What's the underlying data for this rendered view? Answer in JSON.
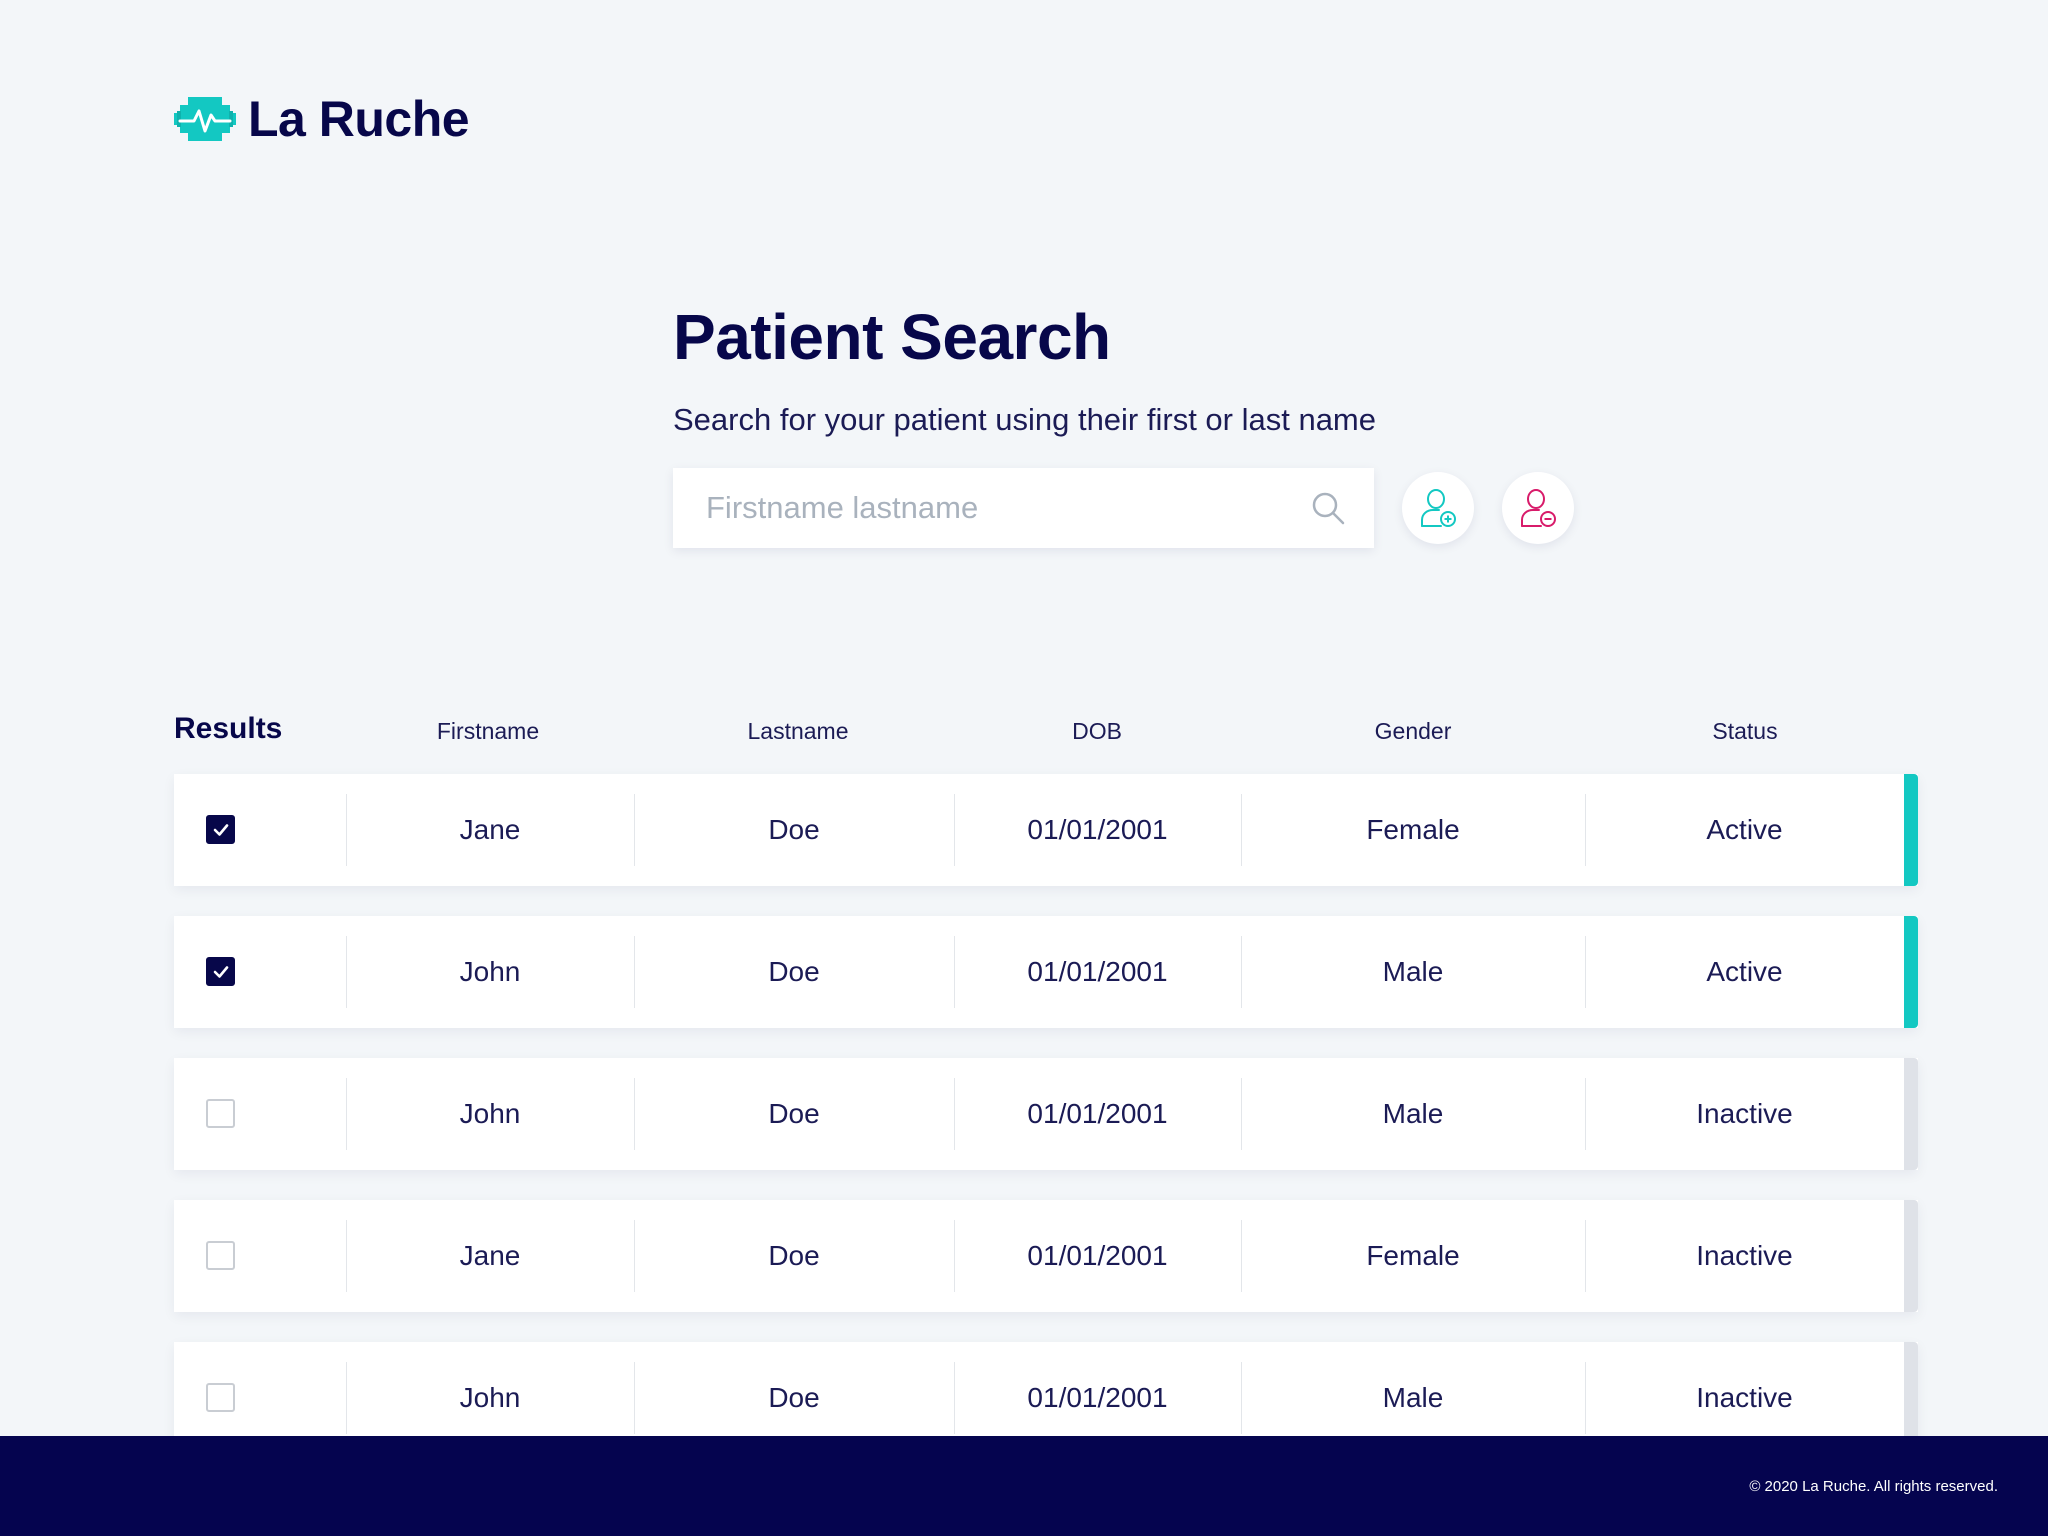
{
  "brand": {
    "name": "La Ruche",
    "icon": "heartbeat-hive-icon",
    "accent": "#13c8c2",
    "primary": "#07074a"
  },
  "page": {
    "title": "Patient Search",
    "subtitle": "Search for your patient using their first or last name"
  },
  "search": {
    "placeholder": "Firstname lastname",
    "value": "",
    "icon": "search-icon"
  },
  "actions": {
    "add_patient_icon": "user-add-icon",
    "remove_patient_icon": "user-remove-icon"
  },
  "results": {
    "label": "Results",
    "columns": [
      "Firstname",
      "Lastname",
      "DOB",
      "Gender",
      "Status"
    ],
    "rows": [
      {
        "checked": true,
        "firstname": "Jane",
        "lastname": "Doe",
        "dob": "01/01/2001",
        "gender": "Female",
        "status": "Active"
      },
      {
        "checked": true,
        "firstname": "John",
        "lastname": "Doe",
        "dob": "01/01/2001",
        "gender": "Male",
        "status": "Active"
      },
      {
        "checked": false,
        "firstname": "John",
        "lastname": "Doe",
        "dob": "01/01/2001",
        "gender": "Male",
        "status": "Inactive"
      },
      {
        "checked": false,
        "firstname": "Jane",
        "lastname": "Doe",
        "dob": "01/01/2001",
        "gender": "Female",
        "status": "Inactive"
      },
      {
        "checked": false,
        "firstname": "John",
        "lastname": "Doe",
        "dob": "01/01/2001",
        "gender": "Male",
        "status": "Inactive"
      }
    ]
  },
  "footer": {
    "copyright": "© 2020 La Ruche. All rights reserved."
  }
}
